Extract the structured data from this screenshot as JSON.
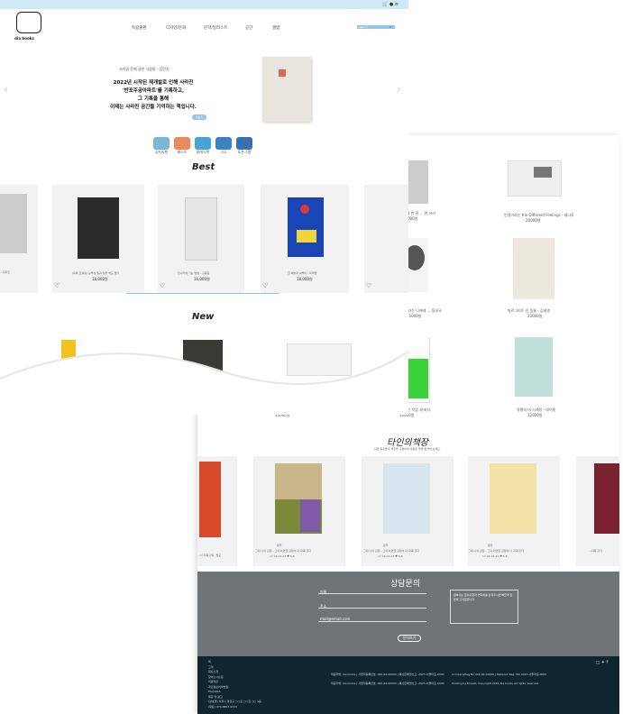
{
  "brand": {
    "logo_text": "dia books"
  },
  "header": {
    "nav": [
      "독립출판",
      "디자인/문화",
      "문학/일러스트",
      "공간",
      "앨범"
    ],
    "search_placeholder": "search"
  },
  "hero": {
    "subtitle": "서지영 문예 글판 사람들 - 김민지",
    "lines": [
      "2022년 시작된 재개발로 인해 사라진",
      "'반포주공아파트'를 기록하고,",
      "그 기록을 통해",
      "이제는 사라진 공간들 기억하는 책입니다."
    ],
    "button_label": "더보기"
  },
  "categories": [
    {
      "label": "공지사항",
      "icon": "speech-bubble-icon",
      "color": "#7bb8d6"
    },
    {
      "label": "베스트",
      "icon": "radio-icon",
      "color": "#e98a5a"
    },
    {
      "label": "클래식북",
      "icon": "gift-icon",
      "color": "#4aa3d6"
    },
    {
      "label": "고소",
      "icon": "envelope-icon",
      "color": "#3b82c4"
    },
    {
      "label": "토론그룹",
      "icon": "megaphone-icon",
      "color": "#3b6fb0"
    }
  ],
  "best": {
    "title": "Best",
    "items": [
      {
        "title": "...러피트",
        "price": ""
      },
      {
        "title": "[독특 프롤링] 눈부심 일과 일을 해도 없다",
        "price": "18,000원"
      },
      {
        "title": "당나라에 가는 방법 - 김용원",
        "price": "16,000원"
      },
      {
        "title": "한 예술과 여백이 - 미래들",
        "price": "18,000원"
      }
    ]
  },
  "new": {
    "title": "New"
  },
  "back_right": {
    "partial_title": "En",
    "items": [
      {
        "title": "이제 한 권 ... 한 쓰러",
        "price": "10000원"
      },
      {
        "title": "인생이라는 the Different Feelings - 레나로",
        "price": "20000원"
      },
      {
        "title": "그녀는 나에게 ... 동네국",
        "price": "15000원"
      },
      {
        "title": "마르그리트 인 동물 - 김세영",
        "price": "23000원"
      },
      {
        "title": "보나 평소의 하는 일 - 김소우",
        "price": "10000원"
      },
      {
        "title": "지난 해 있던 이 미적인 작업 세 바다",
        "price": "10000원"
      },
      {
        "title": "작평의 비 시계링 - 데이빗",
        "price": "12000원"
      }
    ]
  },
  "other_store": {
    "title": "타인의책장",
    "subtitle": "다른 독자들의 책장을 구경하며 새로운 책을 발견해 보세요.",
    "items": [
      {
        "title": "...시 지목 같다, 들교",
        "meta": ""
      },
      {
        "title": "그대 나의 감정 - 그의 외면한 감정이 나 지목 같다",
        "meta": "17 24.02.23 ♥ 5.8"
      },
      {
        "title": "그대 나의 감정 - 그의 외면한 감정이 나 지목 같다",
        "meta": "17 24.02.23 ♥ 5.8"
      },
      {
        "title": "그대 나의 감정 - 그의 외면한 감정이 나 지목 같다",
        "meta": "17 24.02.23 ♥ 5.8"
      },
      {
        "title": "...지목 같다",
        "meta": ""
      }
    ],
    "item_label": "문학"
  },
  "contact": {
    "title": "상담문의",
    "fields": [
      "이름",
      "주소",
      "mail@email.com"
    ],
    "message_placeholder": "원하시는 문의사항과 연락처를 남겨주시면 빠르게 답변해 드리겠습니다.",
    "submit_label": "문의하기"
  },
  "footer": {
    "links": [
      "텍",
      "고객",
      "회사소개",
      "찾아오시는길",
      "이용약관",
      "개인정보처리방침",
      "FAQ/Q&A",
      "제휴 및 광고"
    ],
    "address": "(상호명) 서울시 마포구 ○○로 ○○길 ○○ 1층",
    "phone": "(대표) 070-8867-9333",
    "info1": "대표자명: dia books | 사업자등록번호: 000-00-00000 | 통신판매업신고: 2023-서울마포-0000",
    "info2": "대표자명: dia books | 사업자등록번호: 000-00-00000 | 통신판매업신고: 2023-서울마포-0000",
    "company1": "CompanyReg.No 000-00-00000 | Network Reg. NO 2023-서울마포-0000",
    "company2": "Hosting by tmweb, Copyright 2024 dia books All rights reserved."
  },
  "colors": {
    "topbar": "#cfe9f8",
    "footer": "#0f2530",
    "accent": "#8fc7ea"
  }
}
